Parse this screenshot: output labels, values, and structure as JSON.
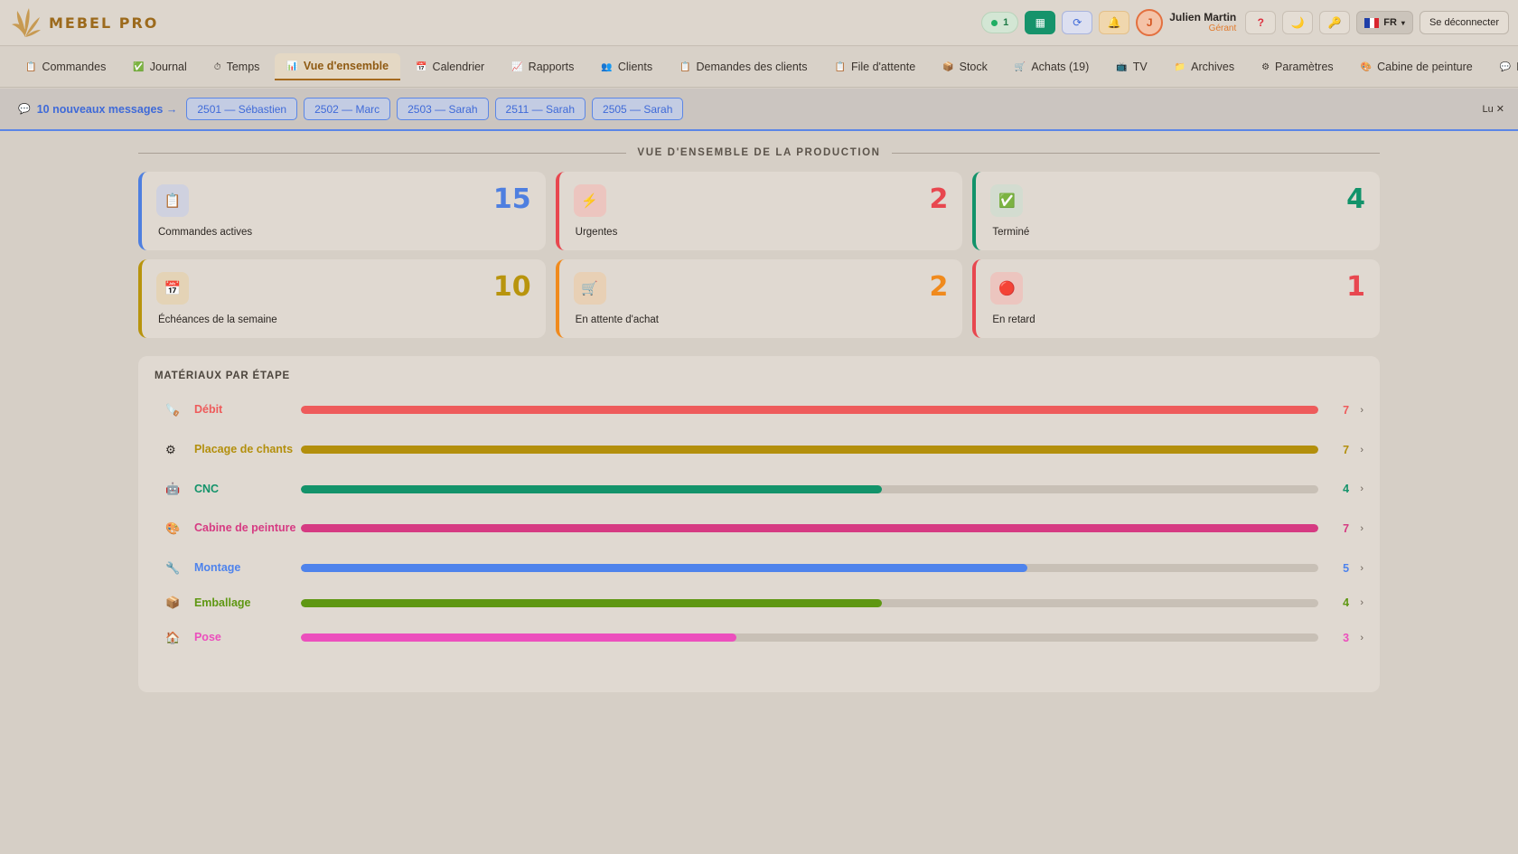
{
  "header": {
    "brand": "MEBEL PRO",
    "online_count": "1",
    "user_name": "Julien Martin",
    "user_role": "Gérant",
    "avatar_initial": "J",
    "help_label": "?",
    "lang": "FR",
    "logout": "Se déconnecter"
  },
  "nav": [
    {
      "icon": "📋",
      "label": "Commandes"
    },
    {
      "icon": "✅",
      "label": "Journal"
    },
    {
      "icon": "⏱",
      "label": "Temps"
    },
    {
      "icon": "📊",
      "label": "Vue d'ensemble",
      "active": true
    },
    {
      "icon": "📅",
      "label": "Calendrier"
    },
    {
      "icon": "📈",
      "label": "Rapports"
    },
    {
      "icon": "👥",
      "label": "Clients"
    },
    {
      "icon": "📋",
      "label": "Demandes des clients"
    },
    {
      "icon": "📋",
      "label": "File d'attente"
    },
    {
      "icon": "📦",
      "label": "Stock"
    },
    {
      "icon": "🛒",
      "label": "Achats (19)"
    },
    {
      "icon": "📺",
      "label": "TV"
    },
    {
      "icon": "📁",
      "label": "Archives"
    },
    {
      "icon": "⚙",
      "label": "Paramètres"
    },
    {
      "icon": "🎨",
      "label": "Cabine de peinture"
    },
    {
      "icon": "💬",
      "label": "Discussion"
    }
  ],
  "messages": {
    "count_label": "10 nouveaux messages →",
    "chips": [
      "2501 — Sébastien",
      "2502 — Marc",
      "2503 — Sarah",
      "2511 — Sarah",
      "2505 — Sarah"
    ],
    "mark_read": "Lu"
  },
  "overview": {
    "title": "VUE D'ENSEMBLE DE LA PRODUCTION",
    "cards": [
      {
        "label": "Commandes actives",
        "value": "15",
        "icon": "📋",
        "color": "#4e7fe0",
        "bg": "#cfd1df"
      },
      {
        "label": "Urgentes",
        "value": "2",
        "icon": "⚡",
        "color": "#e8474f",
        "bg": "#ecc5bf"
      },
      {
        "label": "Terminé",
        "value": "4",
        "icon": "✅",
        "color": "#12936a",
        "bg": "#d3dcd0"
      },
      {
        "label": "Échéances de la semaine",
        "value": "10",
        "icon": "📅",
        "color": "#b8940d",
        "bg": "#e4d3b6"
      },
      {
        "label": "En attente d'achat",
        "value": "2",
        "icon": "🛒",
        "color": "#f08a1d",
        "bg": "#e8d0b5"
      },
      {
        "label": "En retard",
        "value": "1",
        "icon": "🔴",
        "color": "#e8474f",
        "bg": "#ecc5bf"
      }
    ]
  },
  "materials": {
    "title": "MATÉRIAUX PAR ÉTAPE",
    "max": 7,
    "stages": [
      {
        "label": "Débit",
        "count": 7,
        "icon": "🪚",
        "color": "#ee5b5b"
      },
      {
        "label": "Placage de chants",
        "count": 7,
        "icon": "⚙",
        "color": "#b38f0c"
      },
      {
        "label": "CNC",
        "count": 4,
        "icon": "🤖",
        "color": "#13936a"
      },
      {
        "label": "Cabine de peinture",
        "count": 7,
        "icon": "🎨",
        "color": "#d63a82"
      },
      {
        "label": "Montage",
        "count": 5,
        "icon": "🔧",
        "color": "#4e83ec"
      },
      {
        "label": "Emballage",
        "count": 4,
        "icon": "📦",
        "color": "#5e9712"
      },
      {
        "label": "Pose",
        "count": 3,
        "icon": "🏠",
        "color": "#ec4fbd"
      }
    ]
  }
}
